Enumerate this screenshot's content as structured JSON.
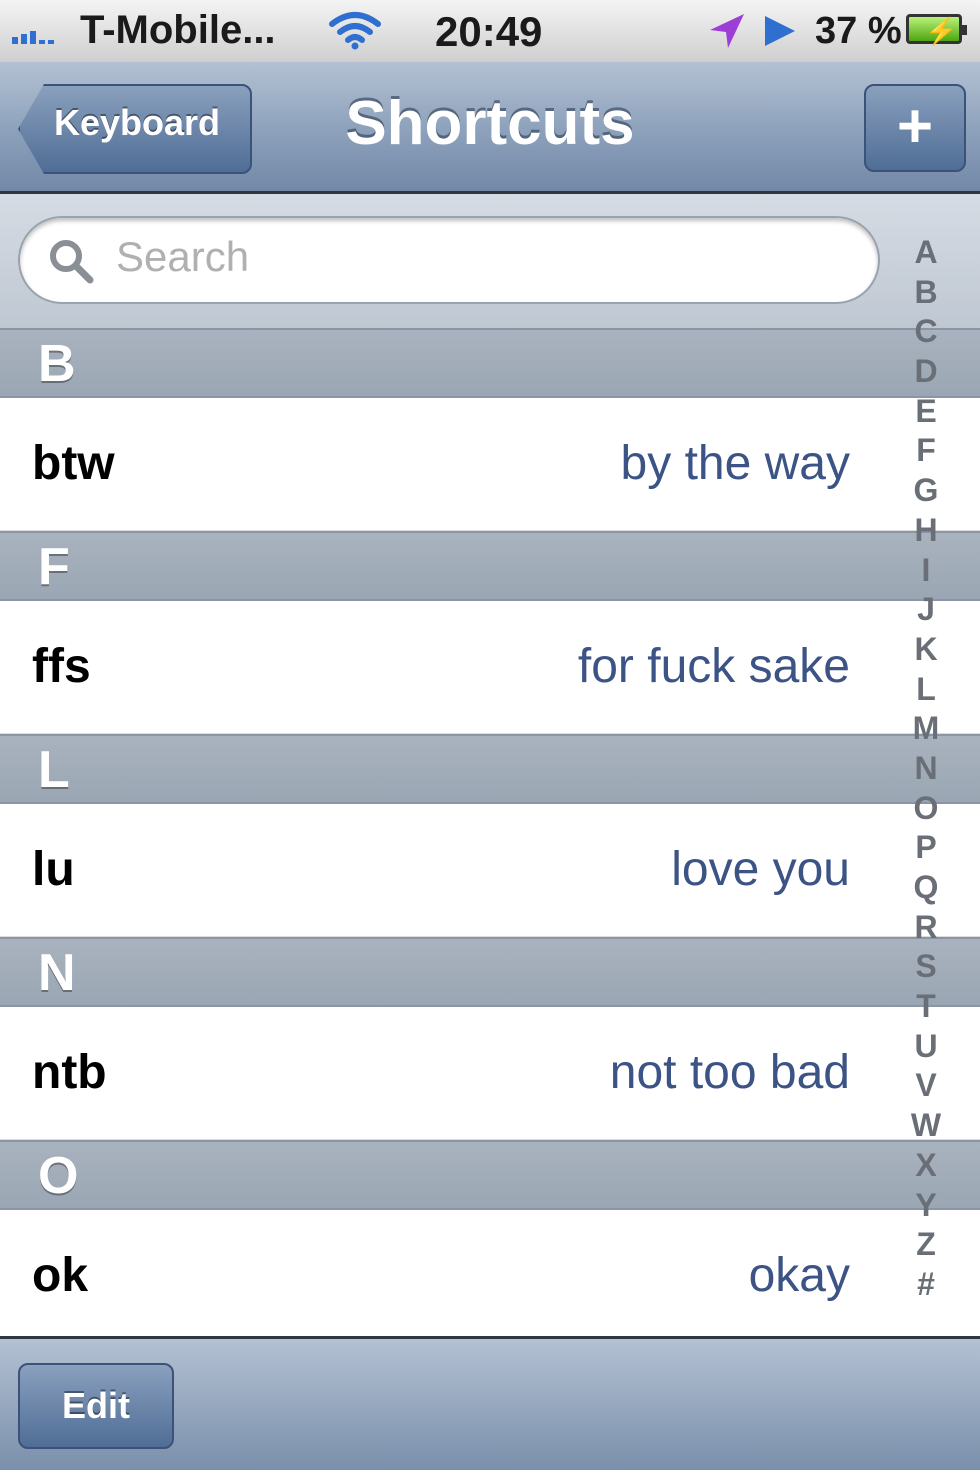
{
  "status_bar": {
    "carrier": "T-Mobile...",
    "time": "20:49",
    "battery_percent": "37 %",
    "icons": [
      "signal-icon",
      "wifi-icon",
      "location-arrow-icon",
      "play-icon",
      "battery-charging-icon"
    ]
  },
  "navbar": {
    "back_label": "Keyboard",
    "title": "Shortcuts",
    "add_label": "+"
  },
  "search": {
    "placeholder": "Search"
  },
  "sections": [
    {
      "letter": "B",
      "items": [
        {
          "shortcut": "btw",
          "phrase": "by the way"
        }
      ]
    },
    {
      "letter": "F",
      "items": [
        {
          "shortcut": "ffs",
          "phrase": "for fuck sake"
        }
      ]
    },
    {
      "letter": "L",
      "items": [
        {
          "shortcut": "lu",
          "phrase": "love you"
        }
      ]
    },
    {
      "letter": "N",
      "items": [
        {
          "shortcut": "ntb",
          "phrase": "not too bad"
        }
      ]
    },
    {
      "letter": "O",
      "items": [
        {
          "shortcut": "ok",
          "phrase": "okay"
        }
      ]
    }
  ],
  "index_letters": [
    "A",
    "B",
    "C",
    "D",
    "E",
    "F",
    "G",
    "H",
    "I",
    "J",
    "K",
    "L",
    "M",
    "N",
    "O",
    "P",
    "Q",
    "R",
    "S",
    "T",
    "U",
    "V",
    "W",
    "X",
    "Y",
    "Z",
    "#"
  ],
  "toolbar": {
    "edit_label": "Edit"
  },
  "colors": {
    "phrase_text": "#3b5385",
    "nav_bar": "#8fa3bd",
    "button": "#5a7599"
  }
}
